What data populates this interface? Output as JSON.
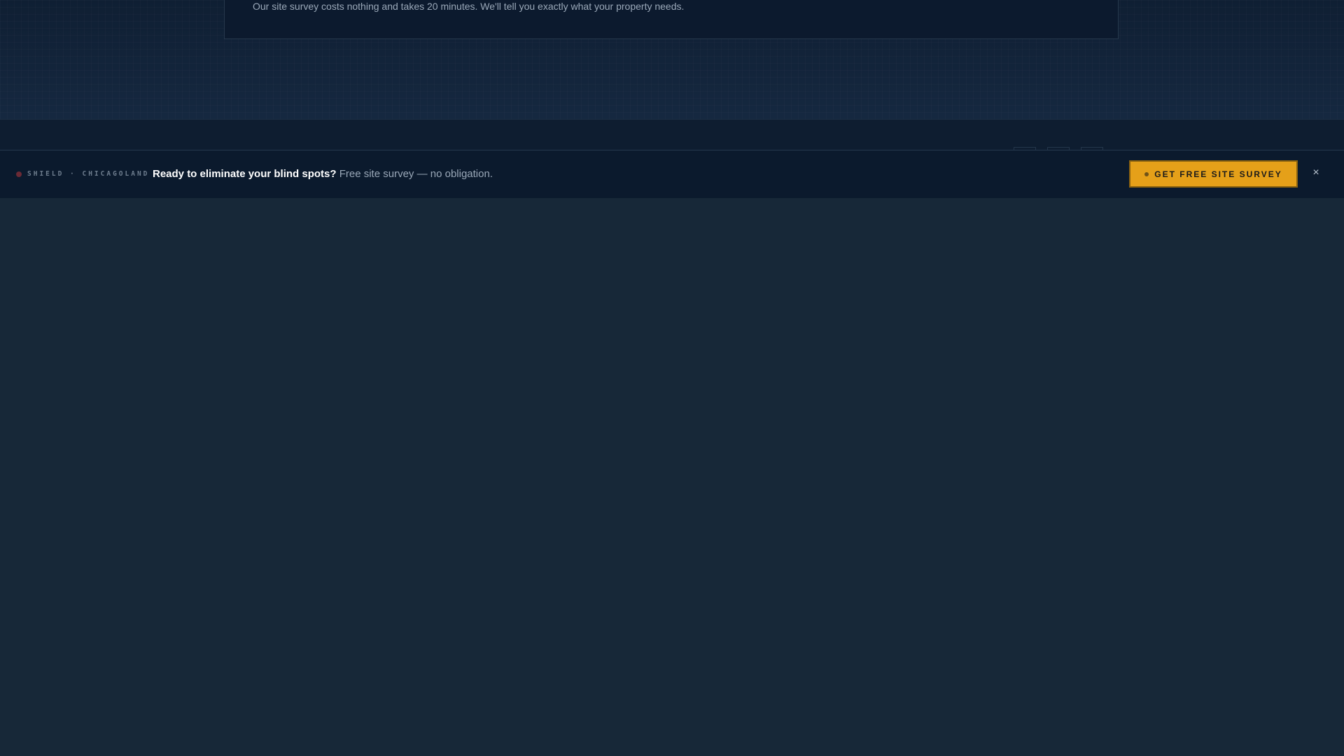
{
  "cta": {
    "text": "Our site survey costs nothing and takes 20 minutes. We'll tell you exactly what your property needs."
  },
  "sticky_bar": {
    "brand": "SHIELD · CHICAGOLAND",
    "headline": "Ready to eliminate your blind spots?",
    "subtext": "Free site survey — no obligation.",
    "button_label": "GET FREE SITE SURVEY",
    "close_label": "×"
  },
  "colors": {
    "accent": "#e5a019",
    "background": "#172838",
    "bar_background": "#0b1a2d",
    "brand_dot": "#6b2a35"
  }
}
